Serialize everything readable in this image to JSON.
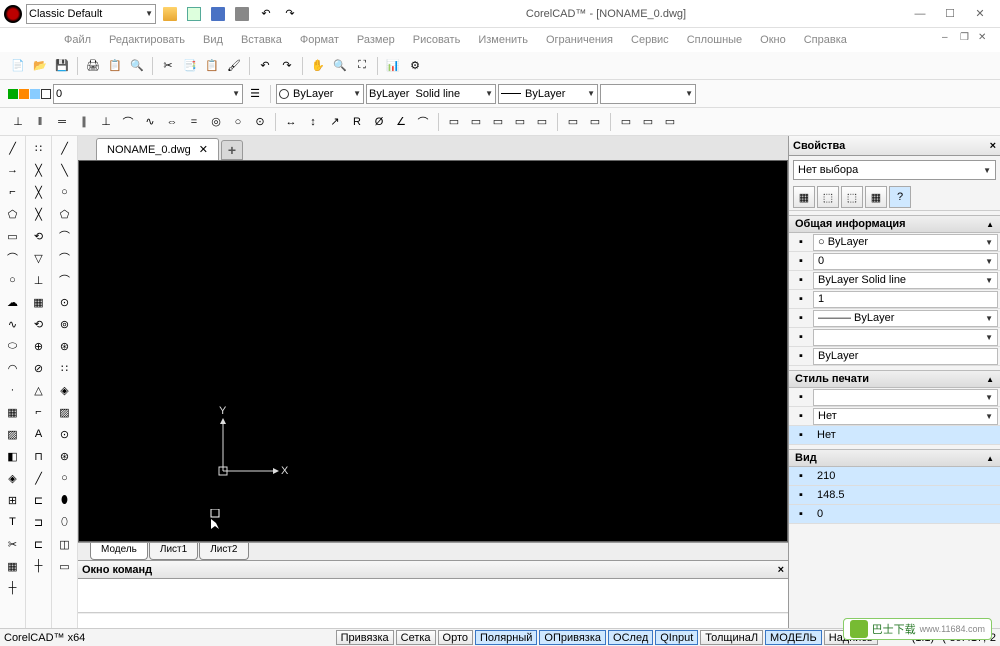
{
  "title": {
    "dropdown_value": "Classic Default",
    "app_title": "CorelCAD™ - [NONAME_0.dwg]"
  },
  "window_controls": {
    "min": "—",
    "max": "☐",
    "close": "✕"
  },
  "mdi_controls": {
    "min": "–",
    "max": "❐",
    "close": "✕"
  },
  "menu": [
    "Файл",
    "Редактировать",
    "Вид",
    "Вставка",
    "Формат",
    "Размер",
    "Рисовать",
    "Изменить",
    "Ограничения",
    "Сервис",
    "Сплошные",
    "Окно",
    "Справка"
  ],
  "layer_row": {
    "layer_name": "0",
    "color_combo": "ByLayer",
    "linetype_combo_1": "ByLayer",
    "linetype_combo_2": "Solid line",
    "lineweight": "ByLayer"
  },
  "document": {
    "tabs": [
      {
        "label": "NONAME_0.dwg"
      }
    ],
    "add_tab": "+",
    "canvas_axes": {
      "x_label": "X",
      "y_label": "Y"
    },
    "sheet_tabs": [
      "Модель",
      "Лист1",
      "Лист2"
    ]
  },
  "properties_panel": {
    "title": "Свойства",
    "close": "×",
    "selection": "Нет выбора",
    "sections": {
      "general": {
        "title": "Общая информация",
        "rows": [
          {
            "icon": "color-swatch",
            "value": "○ ByLayer",
            "dd": true
          },
          {
            "icon": "layer-icon",
            "value": "0",
            "dd": true
          },
          {
            "icon": "linetype-icon",
            "value": "ByLayer    Solid line",
            "dd": true
          },
          {
            "icon": "scale-icon",
            "value": "1",
            "dd": false
          },
          {
            "icon": "lineweight-icon",
            "value": "——— ByLayer",
            "dd": true
          },
          {
            "icon": "transparency-icon",
            "value": "",
            "dd": true
          },
          {
            "icon": "hyperlink-icon",
            "value": "ByLayer",
            "dd": false
          }
        ]
      },
      "print_style": {
        "title": "Стиль печати",
        "rows": [
          {
            "icon": "plot-style-icon",
            "value": "",
            "dd": true
          },
          {
            "icon": "plot-none-icon",
            "value": "Нет",
            "dd": true
          },
          {
            "icon": "plot-none-icon",
            "value": "Нет",
            "dd": false,
            "hl": true
          }
        ]
      },
      "view": {
        "title": "Вид",
        "rows": [
          {
            "icon": "view-angle-icon",
            "value": "210",
            "dd": false,
            "hl": true
          },
          {
            "icon": "view-angle-icon",
            "value": "148.5",
            "dd": false,
            "hl": true
          },
          {
            "icon": "view-angle-icon",
            "value": "0",
            "dd": false,
            "hl": true
          }
        ]
      }
    }
  },
  "command_window": {
    "title": "Окно команд",
    "close": "×"
  },
  "statusbar": {
    "app_label": "CorelCAD™ x64",
    "buttons": [
      {
        "label": "Привязка",
        "active": false
      },
      {
        "label": "Сетка",
        "active": false
      },
      {
        "label": "Орто",
        "active": false
      },
      {
        "label": "Полярный",
        "active": true
      },
      {
        "label": "ОПривязка",
        "active": true
      },
      {
        "label": "ОСлед",
        "active": true
      },
      {
        "label": "QInput",
        "active": true
      },
      {
        "label": "ТолщинаЛ",
        "active": false
      },
      {
        "label": "МОДЕЛЬ",
        "active": true
      },
      {
        "label": "Надпись",
        "active": false
      }
    ],
    "scale": "(1:1)",
    "coords": "(-39.417,-2"
  },
  "watermark": {
    "txt": "巴士下载",
    "url": "www.11684.com"
  }
}
